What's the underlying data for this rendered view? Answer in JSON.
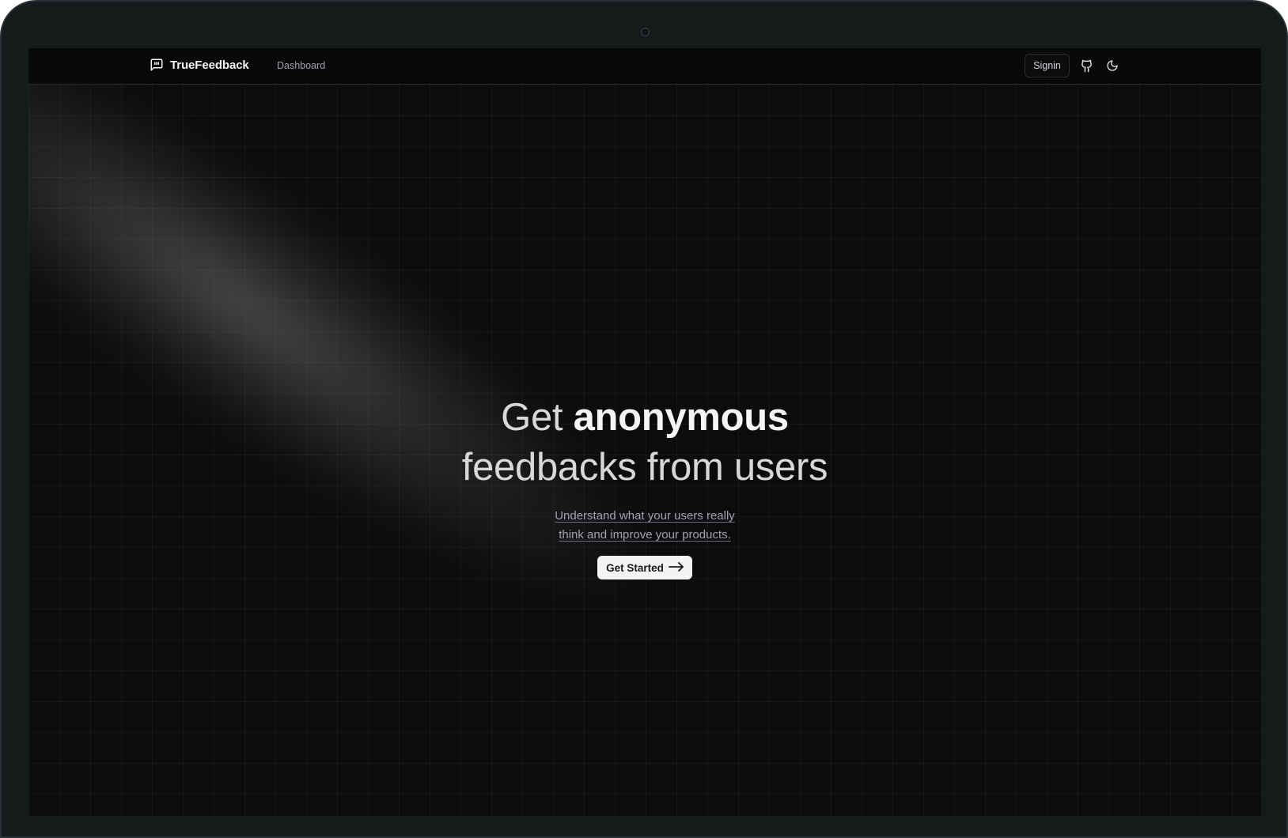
{
  "nav": {
    "brand": "TrueFeedback",
    "dashboard": "Dashboard",
    "signin": "Signin",
    "icons": [
      "message-square-icon",
      "github-icon",
      "moon-icon"
    ]
  },
  "hero": {
    "headline_part1": "Get",
    "headline_part2": "anonymous",
    "headline_line2": "feedbacks from users",
    "subtitle_line1": "Understand what your users really",
    "subtitle_line2": "think and improve your products.",
    "cta": "Get Started"
  },
  "colors": {
    "background": "#0b0c0e",
    "text": "#f5f5f6",
    "muted": "#a3a3ab",
    "button": "#f4f4f5"
  }
}
